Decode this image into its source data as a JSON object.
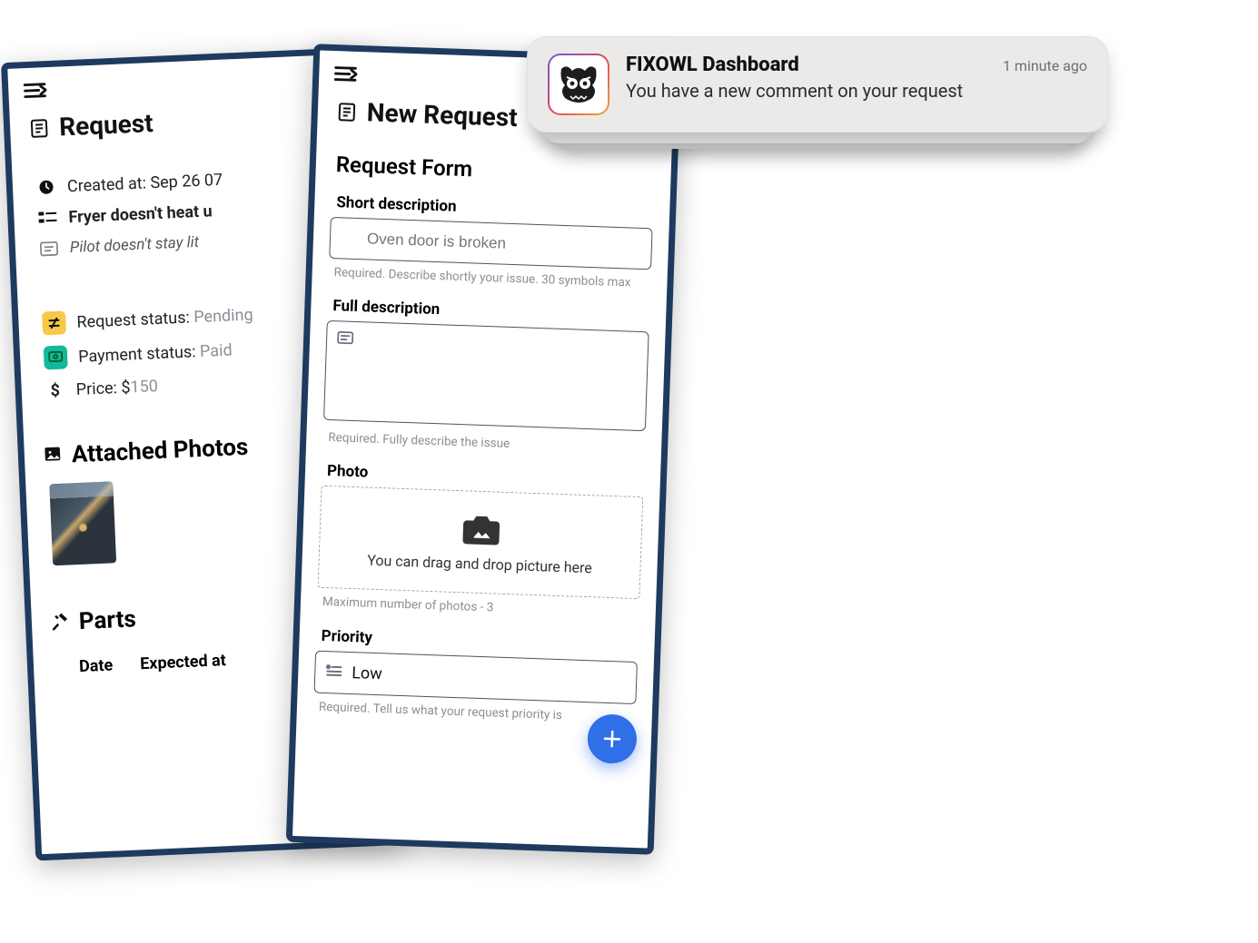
{
  "request_screen": {
    "title": "Request",
    "created_at_label": "Created at:",
    "created_at_value": "Sep 26 07",
    "issue_title": "Fryer doesn't heat u",
    "issue_sub": "Pilot doesn't stay lit",
    "status_label": "Request status:",
    "status_value": "Pending",
    "payment_label": "Payment status:",
    "payment_value": "Paid",
    "price_label": "Price: $",
    "price_value": "150",
    "photos_title": "Attached Photos",
    "parts_title": "Parts",
    "parts_cols": {
      "date": "Date",
      "expected": "Expected at"
    }
  },
  "form_screen": {
    "title": "New Request",
    "form_title": "Request Form",
    "short_label": "Short description",
    "short_placeholder": "Oven door is broken",
    "short_helper": "Required. Describe shortly your issue. 30 symbols max",
    "full_label": "Full description",
    "full_helper": "Required. Fully describe the issue",
    "photo_label": "Photo",
    "photo_dropzone": "You can drag and drop picture here",
    "photo_helper": "Maximum number of photos - 3",
    "priority_label": "Priority",
    "priority_value": "Low",
    "priority_helper": "Required. Tell us what your request priority is"
  },
  "notification": {
    "app_name": "FIXOWL Dashboard",
    "time": "1 minute ago",
    "message": "You have a new comment  on your request"
  }
}
